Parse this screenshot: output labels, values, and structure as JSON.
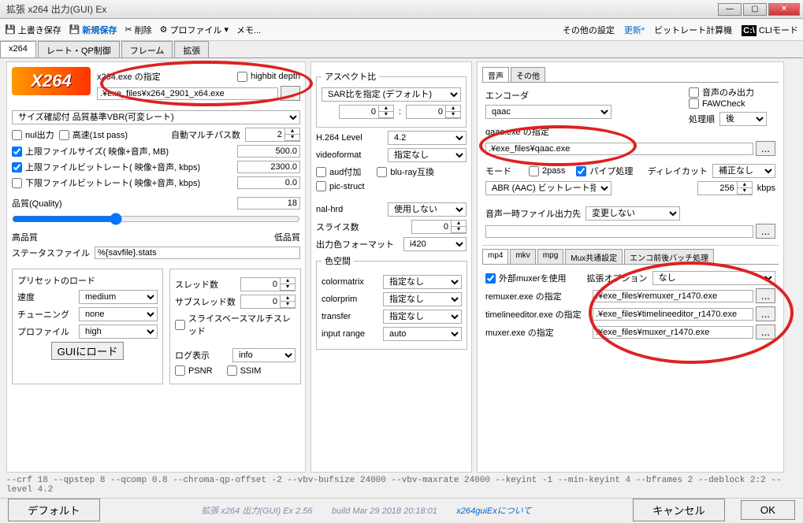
{
  "window": {
    "title": "拡張 x264 出力(GUI) Ex"
  },
  "toolbar": {
    "overwrite": "上書き保存",
    "newsave": "新規保存",
    "delete": "削除",
    "profile": "プロファイル",
    "memo": "メモ...",
    "other": "その他の設定",
    "update": "更新*",
    "bitrate_calc": "ビットレート計算機",
    "cli_mode": "CLIモード"
  },
  "maintabs": [
    "x264",
    "レート・QP制御",
    "フレーム",
    "拡張"
  ],
  "left": {
    "logo": "X264",
    "x264exe_label": "x264.exe の指定",
    "highbit_label": "highbit depth",
    "x264exe_value": ".¥exe_files¥x264_2901_x64.exe",
    "size_mode": "サイズ確認付 品質基準VBR(可変レート)",
    "nul_out": "nul出力",
    "fast1st": "高速(1st pass)",
    "auto_multipass_lbl": "自動マルチパス数",
    "auto_multipass_val": "2",
    "cap_fs_lbl": "上限ファイルサイズ( 映像+音声, MB)",
    "cap_fs_val": "500.0",
    "cap_br_lbl": "上限ファイルビットレート( 映像+音声, kbps)",
    "cap_br_val": "2300.0",
    "low_br_lbl": "下限ファイルビットレート( 映像+音声, kbps)",
    "low_br_val": "0.0",
    "quality_lbl": "品質(Quality)",
    "quality_val": "18",
    "hq_lbl": "高品質",
    "lq_lbl": "低品質",
    "stats_lbl": "ステータスファイル",
    "stats_val": "%{savfile}.stats",
    "preset_title": "プリセットのロード",
    "speed_lbl": "速度",
    "speed_val": "medium",
    "tuning_lbl": "チューニング",
    "tuning_val": "none",
    "profile_lbl": "プロファイル",
    "profile_val": "high",
    "gui_load_btn": "GUIにロード",
    "thread_lbl": "スレッド数",
    "thread_val": "0",
    "subthread_lbl": "サブスレッド数",
    "subthread_val": "0",
    "slice_thread": "スライスベースマルチスレッド",
    "log_lbl": "ログ表示",
    "log_val": "info",
    "psnr": "PSNR",
    "ssim": "SSIM"
  },
  "mid": {
    "aspect_title": "アスペクト比",
    "sar_mode": "SAR比を指定 (デフォルト)",
    "sar_x": "0",
    "sar_y": "0",
    "h264_lbl": "H.264 Level",
    "h264_val": "4.2",
    "vfmt_lbl": "videoformat",
    "vfmt_val": "指定なし",
    "aud": "aud付加",
    "bluray": "blu-ray互換",
    "picstruct": "pic-struct",
    "nalhrd_lbl": "nal-hrd",
    "nalhrd_val": "使用しない",
    "slice_lbl": "スライス数",
    "slice_val": "0",
    "outcolor_lbl": "出力色フォーマット",
    "outcolor_val": "i420",
    "colorspace_title": "色空間",
    "colormatrix_lbl": "colormatrix",
    "colormatrix_val": "指定なし",
    "colorprim_lbl": "colorprim",
    "colorprim_val": "指定なし",
    "transfer_lbl": "transfer",
    "transfer_val": "指定なし",
    "inputrange_lbl": "input range",
    "inputrange_val": "auto"
  },
  "right": {
    "audio_tabs": [
      "音声",
      "その他"
    ],
    "audio_only": "音声のみ出力",
    "fawcheck": "FAWCheck",
    "encoder_lbl": "エンコーダ",
    "encoder_val": "qaac",
    "order_lbl": "処理順",
    "order_val": "後",
    "qaacexe_lbl": "qaac.exe の指定",
    "qaacexe_val": ".¥exe_files¥qaac.exe",
    "mode_lbl": "モード",
    "twopass": "2pass",
    "pipe": "パイプ処理",
    "delay_lbl": "ディレイカット",
    "delay_val": "補正なし",
    "aac_mode": "ABR (AAC) ビットレート指定",
    "aac_br": "256",
    "aac_kbps": "kbps",
    "tmpaudio_lbl": "音声一時ファイル出力先",
    "tmpaudio_val": "変更しない",
    "mux_tabs": [
      "mp4",
      "mkv",
      "mpg",
      "Mux共通設定",
      "エンコ前後バッチ処理"
    ],
    "extmux": "外部muxerを使用",
    "extopt_lbl": "拡張オプション",
    "extopt_val": "なし",
    "remuxer_lbl": "remuxer.exe の指定",
    "remuxer_val": ".¥exe_files¥remuxer_r1470.exe",
    "tleditor_lbl": "timelineeditor.exe の指定",
    "tleditor_val": ".¥exe_files¥timelineeditor_r1470.exe",
    "muxer_lbl": "muxer.exe の指定",
    "muxer_val": ".¥exe_files¥muxer_r1470.exe"
  },
  "cmdline": "--crf 18 --qpstep 8 --qcomp 0.8 --chroma-qp-offset -2 --vbv-bufsize 24000 --vbv-maxrate 24000 --keyint -1 --min-keyint 4 --bframes 2 --deblock 2:2 --level 4.2",
  "footer": {
    "default_btn": "デフォルト",
    "ver": "拡張 x264 出力(GUI) Ex 2.56",
    "build": "build Mar 29 2018 20:18:01",
    "about": "x264guiExについて",
    "cancel": "キャンセル",
    "ok": "OK"
  }
}
